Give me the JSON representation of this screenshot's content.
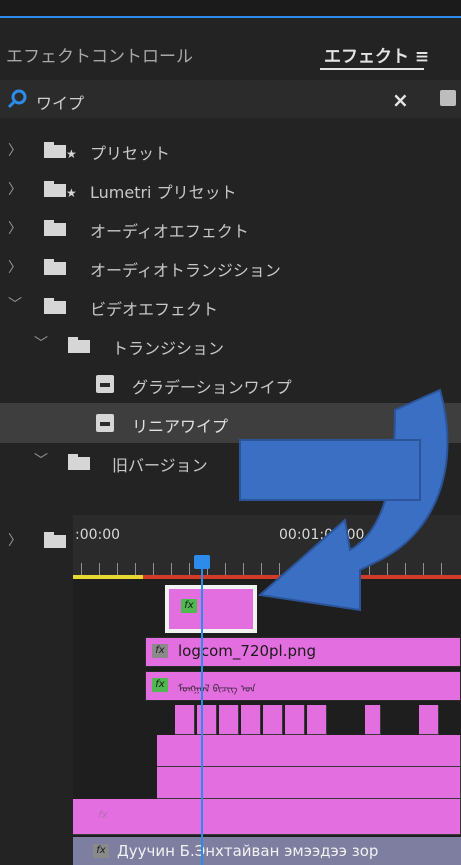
{
  "tabs": {
    "effect_controls": "エフェクトコントロール",
    "effects": "エフェクト ≡"
  },
  "search": {
    "value": "ワイプ",
    "icon": "search-icon",
    "clear_icon": "×"
  },
  "tree": [
    {
      "label": "プリセット",
      "type": "preset-folder",
      "expanded": false
    },
    {
      "label": "Lumetri プリセット",
      "type": "preset-folder",
      "expanded": false
    },
    {
      "label": "オーディオエフェクト",
      "type": "folder",
      "expanded": false
    },
    {
      "label": "オーディオトランジション",
      "type": "folder",
      "expanded": false
    },
    {
      "label": "ビデオエフェクト",
      "type": "folder",
      "expanded": true
    },
    {
      "label": "トランジション",
      "type": "folder",
      "expanded": true
    },
    {
      "label": "グラデーションワイプ",
      "type": "effect"
    },
    {
      "label": "リニアワイプ",
      "type": "effect",
      "selected": true
    },
    {
      "label": "旧バージョン",
      "type": "folder",
      "expanded": true
    }
  ],
  "timeline": {
    "timecode_start": ":00:00",
    "timecode_mid": "00:01:00:00",
    "clip_logo": "logcom_720pl.png",
    "clip_script": "ᠮᠣᠩᠭᠣᠯ ᠪᠢᠴᠢᠭ᠌ ᠤᠨ",
    "clip_fx": "fx",
    "clip_bottom": "Дуучин Б.Энхтайван эмээдээ зор"
  },
  "colors": {
    "accent_blue": "#2d8ceb",
    "clip_pink": "#e36ee0",
    "fx_green": "#4fb84f",
    "arrow_blue": "#3a6fc4"
  }
}
